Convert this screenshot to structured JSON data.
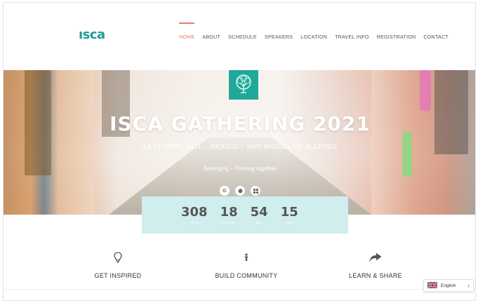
{
  "header": {
    "logo": "ısca",
    "nav": [
      "HOME",
      "ABOUT",
      "SCHEDULE",
      "SPEAKERS",
      "LOCATION",
      "TRAVEL INFO",
      "REGISTRATION",
      "CONTACT"
    ],
    "active_nav": "HOME"
  },
  "hero": {
    "title": "ISCA GATHERING 2021",
    "subtitle": "14-18 APRIL 2021 – MEXICO – SAN MIGUEL DE ALLENDE",
    "tagline": "Belonging – Thriving together",
    "store_icons": [
      "google-icon",
      "apple-icon",
      "windows-icon"
    ]
  },
  "countdown": [
    {
      "value": "308",
      "label": "DAYS"
    },
    {
      "value": "18",
      "label": "HOURS"
    },
    {
      "value": "54",
      "label": "MIN"
    },
    {
      "value": "15",
      "label": "SEC"
    }
  ],
  "features": [
    {
      "label": "GET INSPIRED",
      "icon": "lightbulb-icon"
    },
    {
      "label": "BUILD COMMUNITY",
      "icon": "person-icon"
    },
    {
      "label": "LEARN & SHARE",
      "icon": "share-arrow-icon"
    }
  ],
  "language": {
    "label": "English",
    "flag": "uk-flag-icon"
  },
  "colors": {
    "accent": "#ea7b6d",
    "brand": "#1f9d95",
    "countdown_bg": "#cfeeed"
  }
}
